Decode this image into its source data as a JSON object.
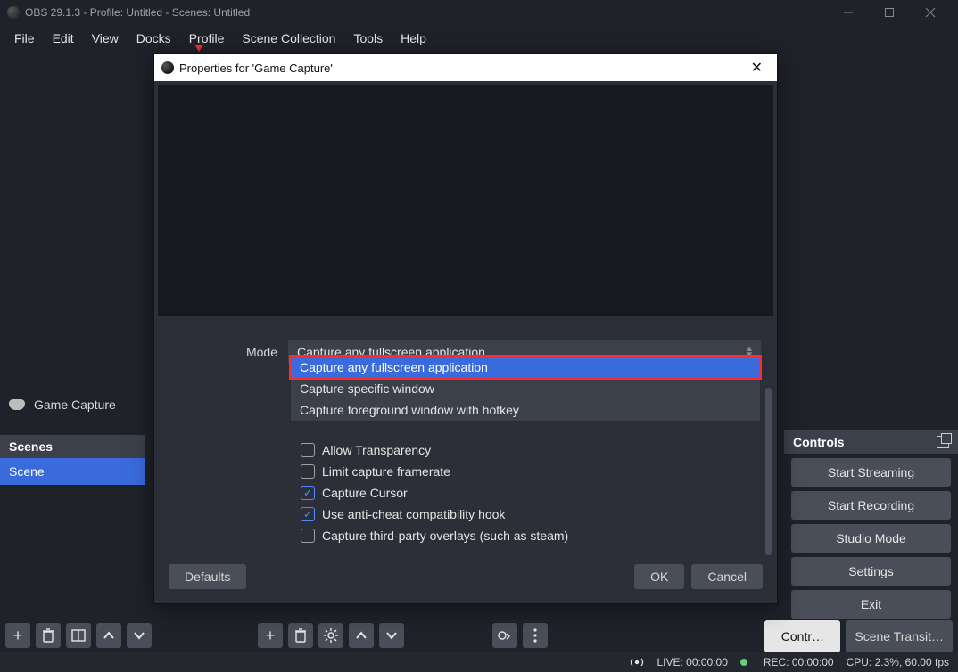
{
  "titlebar": {
    "text": "OBS 29.1.3 - Profile: Untitled - Scenes: Untitled"
  },
  "menu": {
    "file": "File",
    "edit": "Edit",
    "view": "View",
    "docks": "Docks",
    "profile": "Profile",
    "scene_collection": "Scene Collection",
    "tools": "Tools",
    "help": "Help"
  },
  "sources": {
    "item1": "Game Capture"
  },
  "scenes": {
    "header": "Scenes",
    "item1": "Scene"
  },
  "controls": {
    "header": "Controls",
    "start_streaming": "Start Streaming",
    "start_recording": "Start Recording",
    "studio_mode": "Studio Mode",
    "settings": "Settings",
    "exit": "Exit"
  },
  "tabs": {
    "controls": "Contr…",
    "scene_transitions": "Scene Transit…"
  },
  "status": {
    "live": "LIVE: 00:00:00",
    "rec": "REC: 00:00:00",
    "cpu": "CPU: 2.3%, 60.00 fps"
  },
  "modal": {
    "title": "Properties for 'Game Capture'",
    "mode_label": "Mode",
    "mode_value": "Capture any fullscreen application",
    "options": {
      "o1": "Capture any fullscreen application",
      "o2": "Capture specific window",
      "o3": "Capture foreground window with hotkey"
    },
    "chk_transparency": "Allow Transparency",
    "chk_limit": "Limit capture framerate",
    "chk_cursor": "Capture Cursor",
    "chk_anticheat": "Use anti-cheat compatibility hook",
    "chk_thirdparty": "Capture third-party overlays (such as steam)",
    "defaults": "Defaults",
    "ok": "OK",
    "cancel": "Cancel"
  }
}
